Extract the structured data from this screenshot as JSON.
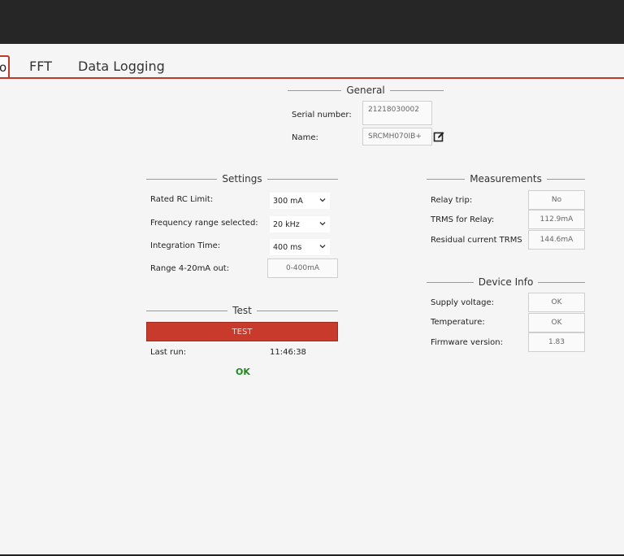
{
  "tabs": [
    {
      "label": "o"
    },
    {
      "label": "FFT"
    },
    {
      "label": "Data Logging"
    }
  ],
  "general": {
    "title": "General",
    "serial_label": "Serial number:",
    "serial_value": "21218030002",
    "name_label": "Name:",
    "name_value": "SRCMH070IB+"
  },
  "settings": {
    "title": "Settings",
    "rated_label": "Rated RC Limit:",
    "rated_value": "300 mA",
    "freq_label": "Frequency range selected:",
    "freq_value": "20 kHz",
    "integ_label": "Integration Time:",
    "integ_value": "400 ms",
    "range_label": "Range 4-20mA out:",
    "range_value": "0-400mA"
  },
  "test": {
    "title": "Test",
    "button_label": "TEST",
    "last_run_label": "Last run:",
    "last_run_value": "11:46:38",
    "result": "OK"
  },
  "measurements": {
    "title": "Measurements",
    "relay_label": "Relay trip:",
    "relay_value": "No",
    "trms_relay_label": "TRMS for Relay:",
    "trms_relay_value": "112.9mA",
    "residual_label": "Residual current TRMS",
    "residual_value": "144.6mA"
  },
  "device_info": {
    "title": "Device Info",
    "supply_label": "Supply voltage:",
    "supply_value": "OK",
    "temp_label": "Temperature:",
    "temp_value": "OK",
    "firmware_label": "Firmware version:",
    "firmware_value": "1.83"
  },
  "colors": {
    "accent": "#c0392b",
    "ok": "#1e8a1e",
    "titlebar": "#262626"
  }
}
